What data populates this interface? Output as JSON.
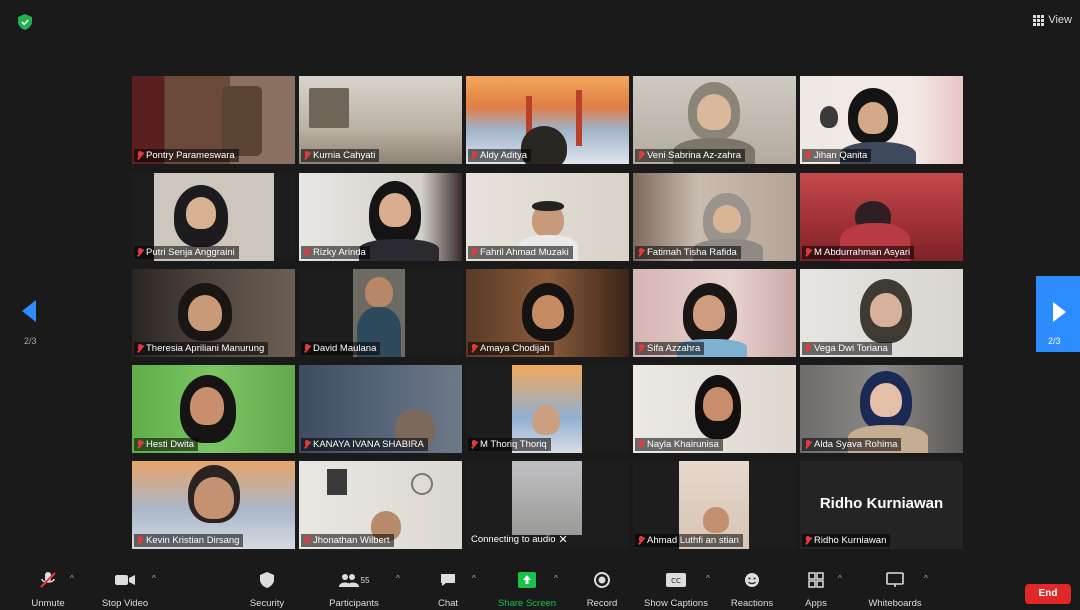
{
  "top": {
    "view_label": "View"
  },
  "pagination": {
    "left": "2/3",
    "right": "2/3"
  },
  "participants": [
    "Pontry Parameswara",
    "Kurnia Cahyati",
    "Aldy Aditya",
    "Veni Sabrina Az-zahra",
    "Jihan Qanita",
    "Putri Senja Anggraini",
    "Rizky Arinda",
    "Fahril Ahmad Muzaki",
    "Fatimah Tisha Rafida",
    "M Abdurrahman Asyari",
    "Theresia Apriliani Manurung",
    "David Maulana",
    "Amaya Chodijah",
    "Sifa Azzahra",
    "Vega Dwi Toriana",
    "Hesti Dwita",
    "KANAYA IVANA SHABIRA",
    "M Thoriq Thoriq",
    "Nayla Khairunisa",
    "Alda Syava Rohima",
    "Kevin Kristian Dirsang",
    "Jhonathan Wilbert",
    "Connecting to audio",
    "Ahmad Luthfi an stian",
    "Ridho Kurniawan"
  ],
  "big_name": "Ridho Kurniawan",
  "toolbar": {
    "unmute": "Unmute",
    "stop_video": "Stop Video",
    "security": "Security",
    "participants": "Participants",
    "participants_count": "55",
    "chat": "Chat",
    "share_screen": "Share Screen",
    "record": "Record",
    "show_captions": "Show Captions",
    "reactions": "Reactions",
    "apps": "Apps",
    "whiteboards": "Whiteboards",
    "end": "End"
  },
  "colors": {
    "accent": "#2d8cff",
    "share": "#19c34a",
    "end": "#e02828",
    "muted_mic": "#e23b3b"
  }
}
